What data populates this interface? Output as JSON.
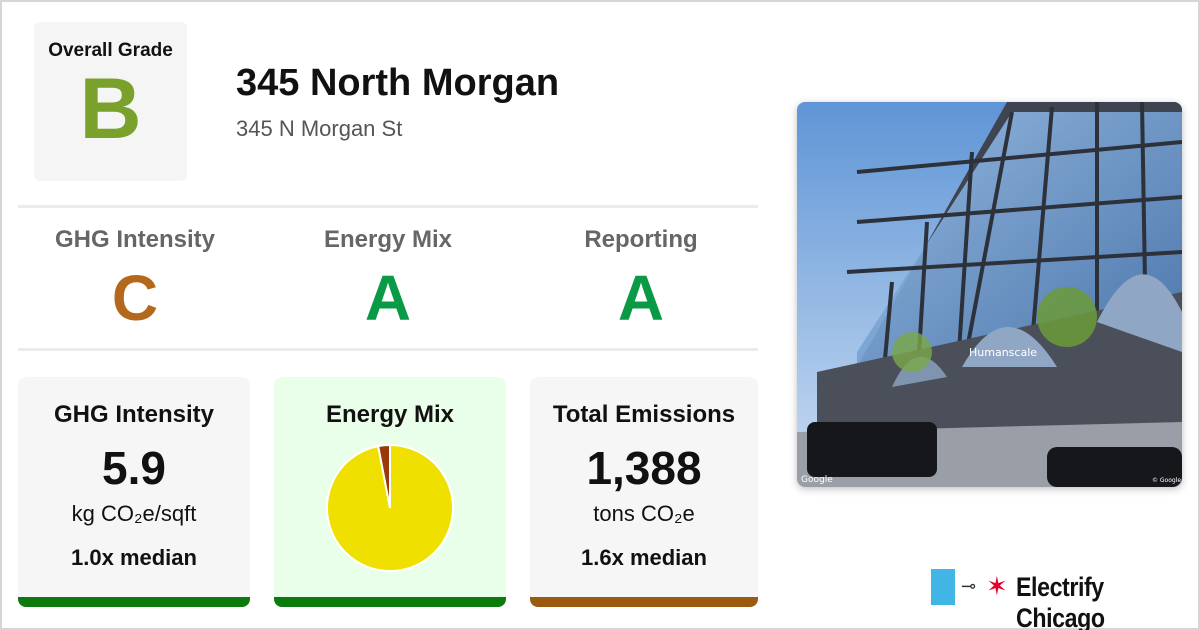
{
  "overall_grade": {
    "label": "Overall Grade",
    "value": "B",
    "color": "#7aa12c"
  },
  "building": {
    "name": "345 North Morgan",
    "address": "345 N Morgan St"
  },
  "sub_grades": [
    {
      "label": "GHG Intensity",
      "value": "C",
      "color": "#b3681c"
    },
    {
      "label": "Energy Mix",
      "value": "A",
      "color": "#0a9a45"
    },
    {
      "label": "Reporting",
      "value": "A",
      "color": "#0a9a45"
    }
  ],
  "cards": {
    "ghg": {
      "title": "GHG Intensity",
      "value": "5.9",
      "unit": "kg CO₂e/sqft",
      "median": "1.0x median",
      "bar_color": "#0c7a0c"
    },
    "energy": {
      "title": "Energy Mix",
      "bar_color": "#0c7a0c",
      "pie_colors": [
        "#f0e000",
        "#9a3a0a"
      ]
    },
    "emissions": {
      "title": "Total Emissions",
      "value": "1,388",
      "unit": "tons CO₂e",
      "median": "1.6x median",
      "bar_color": "#9a5a10"
    }
  },
  "chart_data": {
    "type": "pie",
    "values": [
      97,
      3
    ],
    "colors": [
      "#f0e000",
      "#9a3a0a"
    ]
  },
  "photo": {
    "sign_text": "Humanscale",
    "watermark_left": "Google",
    "watermark_right": "© Google"
  },
  "brand": {
    "name": "Electrify Chicago",
    "accent": "#41b6e6",
    "star_color": "#e4002b"
  }
}
